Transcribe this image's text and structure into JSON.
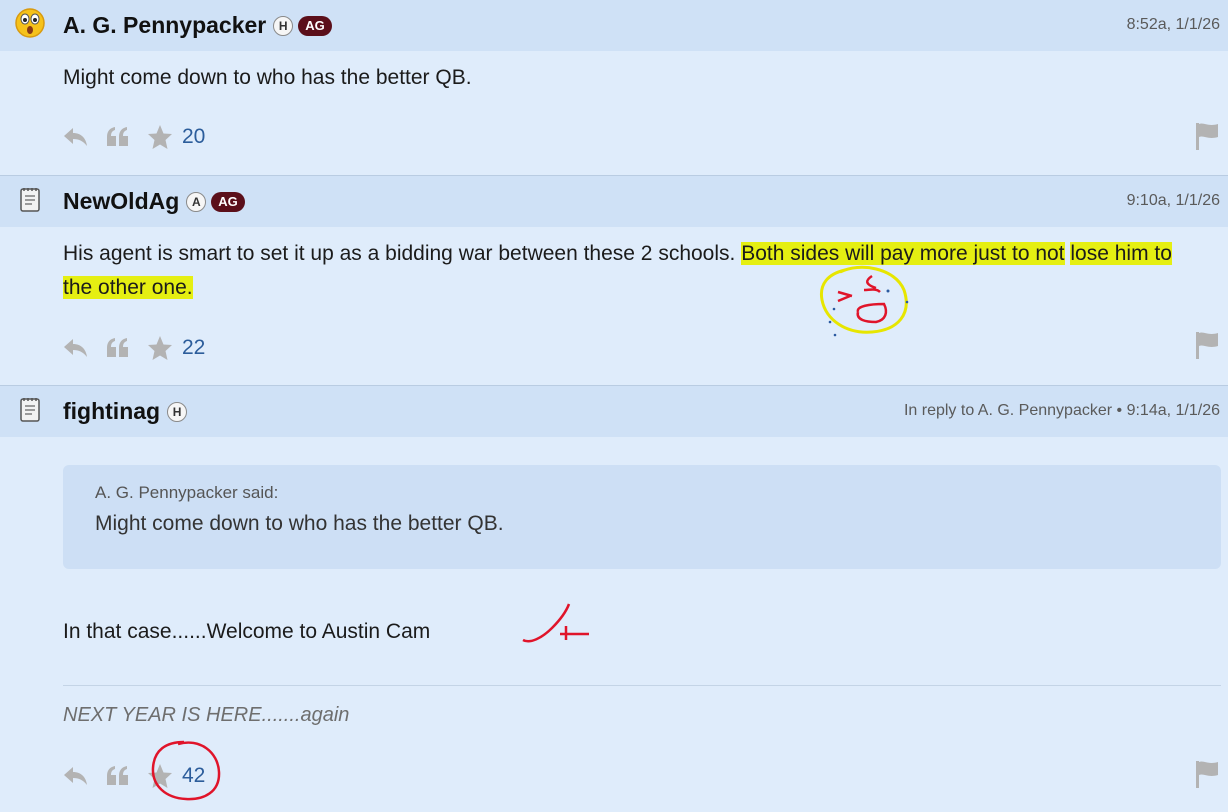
{
  "posts": [
    {
      "username": "A. G. Pennypacker",
      "badge_h": "H",
      "badge_ag": "AG",
      "timestamp": "8:52a, 1/1/26",
      "body": "Might come down to who has the better QB.",
      "star_count": "20",
      "avatar_icon": "surprised-emoji-icon"
    },
    {
      "username": "NewOldAg",
      "badge_a": "A",
      "badge_ag": "AG",
      "timestamp": "9:10a, 1/1/26",
      "body_plain": "His agent is smart to set it up as a bidding war between these 2 schools.",
      "body_highlight_1": "Both sides will pay more just to not",
      "body_highlight_2": "lose him to the other one.",
      "star_count": "22",
      "avatar_icon": "notepad-icon"
    },
    {
      "username": "fightinag",
      "badge_h": "H",
      "reply_to": "In reply to A. G. Pennypacker",
      "bullet": "•",
      "timestamp": "9:14a, 1/1/26",
      "quote_author": "A. G. Pennypacker said:",
      "quote_text": "Might come down to who has the better QB.",
      "body": "In that case......Welcome to Austin Cam",
      "signature": "NEXT YEAR IS HERE.......again",
      "star_count": "42",
      "avatar_icon": "notepad-icon"
    }
  ],
  "colors": {
    "page_bg": "#dfecfb",
    "header_bg": "#cfe1f6",
    "ag_badge": "#5b0f1a",
    "highlight": "#e5ef12",
    "count_blue": "#2c5d9b",
    "annotation_red": "#e0142a",
    "annotation_yellow": "#e7e600"
  }
}
